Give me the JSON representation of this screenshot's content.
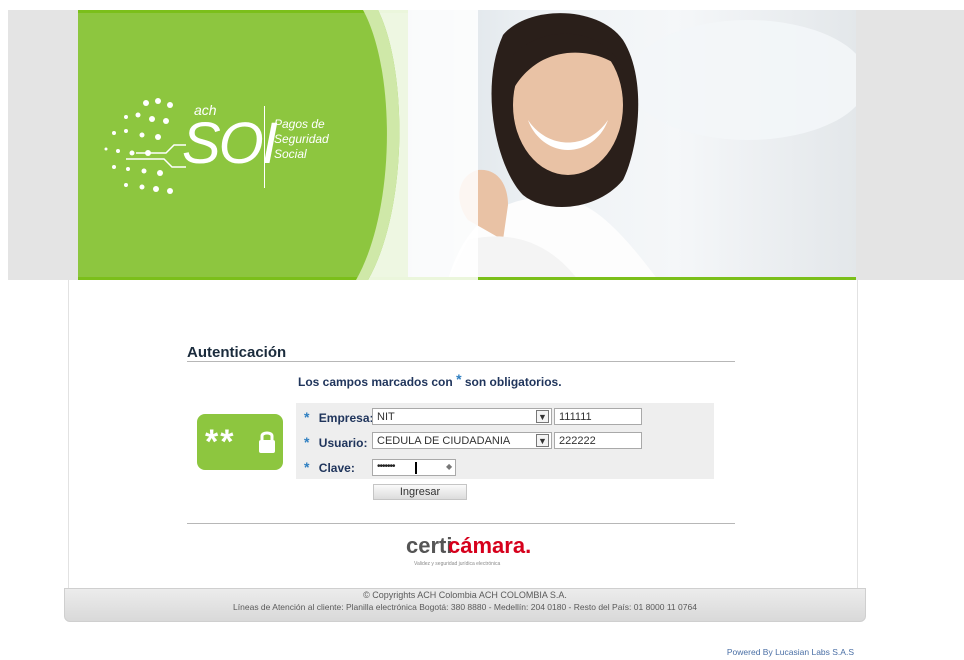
{
  "banner": {
    "brand_small": "ach",
    "brand_big": "SOI",
    "tagline_line1": "Pagos de",
    "tagline_line2": "Seguridad",
    "tagline_line3": "Social"
  },
  "auth": {
    "title": "Autenticación",
    "required_note_prefix": "Los campos marcados con",
    "required_star": "*",
    "required_note_suffix": "son obligatorios."
  },
  "form": {
    "empresa_label": "Empresa:",
    "empresa_type": "NIT",
    "empresa_value": "111111",
    "usuario_label": "Usuario:",
    "usuario_type": "CEDULA DE CIUDADANIA",
    "usuario_value": "222222",
    "clave_label": "Clave:",
    "clave_value": "•••••••",
    "submit_label": "Ingresar"
  },
  "lock_badge": {
    "text": "**"
  },
  "certicamara": {
    "part1": "certi",
    "part2": "cámara.",
    "tagline": "Validez y seguridad jurídica electrónica"
  },
  "footer": {
    "copyright": "© Copyrights ACH Colombia ACH COLOMBIA S.A.",
    "attention": "Líneas de Atención al cliente: Planilla electrónica Bogotá: 380 8880 - Medellín: 204 0180 - Resto del País: 01 8000 11 0764",
    "powered": "Powered By Lucasian Labs S.A.S"
  },
  "colors": {
    "brand_green": "#8dc63f",
    "accent_blue": "#2f7fc1",
    "cert_red": "#d6001c"
  }
}
